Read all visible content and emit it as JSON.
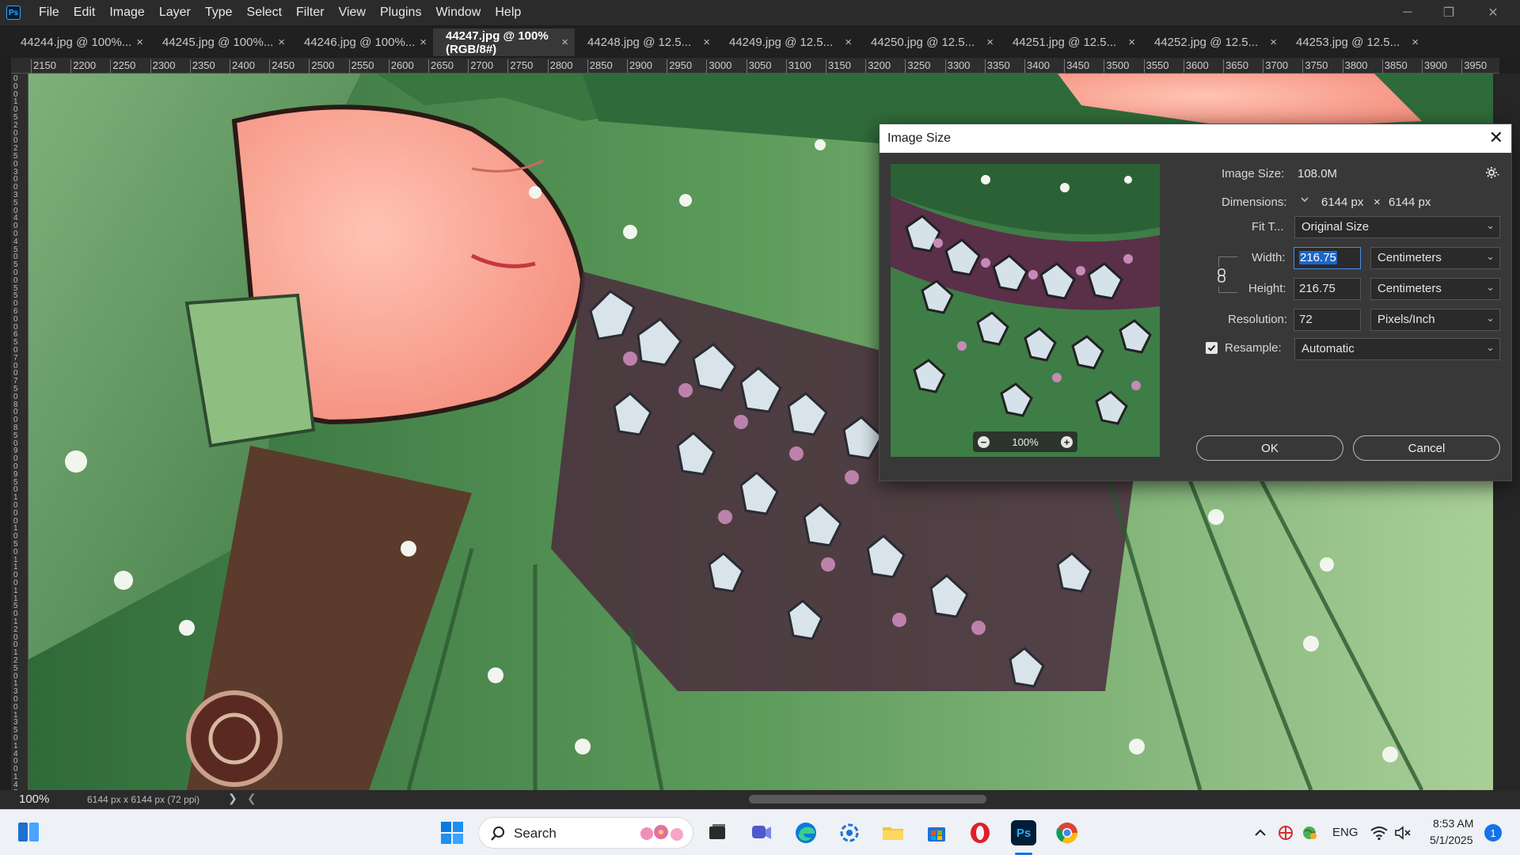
{
  "app": {
    "logo": "Ps"
  },
  "menu": [
    "File",
    "Edit",
    "Image",
    "Layer",
    "Type",
    "Select",
    "Filter",
    "View",
    "Plugins",
    "Window",
    "Help"
  ],
  "window_controls": {
    "minimize": "─",
    "restore": "❐",
    "close": "✕"
  },
  "tabs": [
    {
      "label": "44244.jpg @ 100%...",
      "active": false
    },
    {
      "label": "44245.jpg @ 100%...",
      "active": false
    },
    {
      "label": "44246.jpg @ 100%...",
      "active": false
    },
    {
      "label": "44247.jpg @ 100% (RGB/8#)",
      "active": true
    },
    {
      "label": "44248.jpg @ 12.5...",
      "active": false
    },
    {
      "label": "44249.jpg @ 12.5...",
      "active": false
    },
    {
      "label": "44250.jpg @ 12.5...",
      "active": false
    },
    {
      "label": "44251.jpg @ 12.5...",
      "active": false
    },
    {
      "label": "44252.jpg @ 12.5...",
      "active": false
    },
    {
      "label": "44253.jpg @ 12.5...",
      "active": false
    }
  ],
  "tab_close_glyph": "×",
  "ruler": {
    "horizontal": [
      "2150",
      "2200",
      "2250",
      "2300",
      "2350",
      "2400",
      "2450",
      "2500",
      "2550",
      "2600",
      "2650",
      "2700",
      "2750",
      "2800",
      "2850",
      "2900",
      "2950",
      "3000",
      "3050",
      "3100",
      "3150",
      "3200",
      "3250",
      "3300",
      "3350",
      "3400",
      "3450",
      "3500",
      "3550",
      "3600",
      "3650",
      "3700",
      "3750",
      "3800",
      "3850",
      "3900",
      "3950"
    ],
    "vertical_digits": [
      "0",
      "0",
      "0",
      "1",
      "0",
      "5",
      "2",
      "0",
      "0",
      "2",
      "5",
      "0",
      "3",
      "0",
      "0",
      "3",
      "5",
      "0",
      "4",
      "0",
      "0",
      "4",
      "5",
      "0",
      "5",
      "0",
      "0",
      "5",
      "5",
      "0",
      "6",
      "0",
      "0",
      "6",
      "5",
      "0",
      "7",
      "0",
      "0",
      "7",
      "5",
      "0",
      "8",
      "0",
      "0",
      "8",
      "5",
      "0",
      "9",
      "0",
      "0",
      "9",
      "5",
      "0",
      "1",
      "0",
      "0",
      "0",
      "1",
      "0",
      "5",
      "0",
      "1",
      "1",
      "0",
      "0",
      "1",
      "1",
      "5",
      "0",
      "1",
      "2",
      "0",
      "0",
      "1",
      "2",
      "5",
      "0",
      "1",
      "3",
      "0",
      "0",
      "1",
      "3",
      "5",
      "0",
      "1",
      "4",
      "0",
      "0",
      "1",
      "4",
      "5"
    ]
  },
  "status": {
    "zoom": "100%",
    "doc_info": "6144 px x 6144 px (72 ppi)",
    "arrow": "❯",
    "left_arrow": "❮"
  },
  "dialog": {
    "title": "Image Size",
    "close": "✕",
    "preview_zoom": "100%",
    "zoom_out": "−",
    "zoom_in": "+",
    "image_size_label": "Image Size:",
    "image_size_value": "108.0M",
    "dimensions_label": "Dimensions:",
    "dimensions_width": "6144 px",
    "dimensions_x": "×",
    "dimensions_height": "6144 px",
    "fit_label": "Fit T...",
    "fit_value": "Original Size",
    "width_label": "Width:",
    "width_value": "216.75",
    "width_unit": "Centimeters",
    "height_label": "Height:",
    "height_value": "216.75",
    "height_unit": "Centimeters",
    "resolution_label": "Resolution:",
    "resolution_value": "72",
    "resolution_unit": "Pixels/Inch",
    "resample_label": "Resample:",
    "resample_checked": true,
    "resample_value": "Automatic",
    "ok_label": "OK",
    "cancel_label": "Cancel",
    "gear_icon": "gear-icon",
    "link_icon": "chain-link-icon"
  },
  "taskbar": {
    "search_placeholder": "Search",
    "language": "ENG",
    "time": "8:53 AM",
    "date": "5/1/2025",
    "notifications": "1"
  }
}
